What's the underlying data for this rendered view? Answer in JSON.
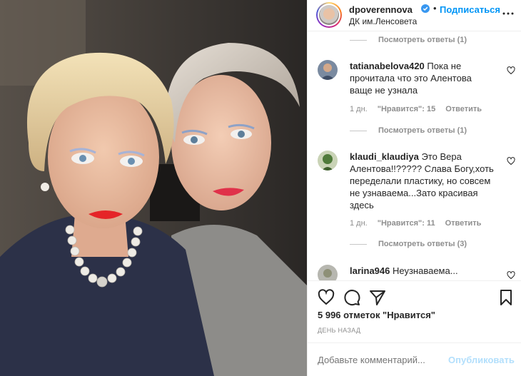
{
  "post": {
    "username": "dpoverennova",
    "follow_label": "Подписаться",
    "separator": "•",
    "location": "ДК им.Ленсовета",
    "photo_alt": "Селфи двух женщин"
  },
  "comments": {
    "view_replies_top": "Посмотреть ответы (1)",
    "items": [
      {
        "username": "tatianabelova420",
        "text": "Пока не прочитала что это Алентова ваще не узнала",
        "time": "1 дн.",
        "likes": "\"Нравится\": 15",
        "reply": "Ответить",
        "view_replies": "Посмотреть ответы (1)"
      },
      {
        "username": "klaudi_klaudiya",
        "text": "Это Вера Алентова!!????? Слава Богу,хоть переделали пластику, но совсем не узнаваема...Зато красивая здесь",
        "time": "1 дн.",
        "likes": "\"Нравится\": 11",
        "reply": "Ответить",
        "view_replies": "Посмотреть ответы (3)"
      },
      {
        "username": "larina946",
        "text": "Неузнаваема..."
      }
    ]
  },
  "actions": {
    "likes_count": "5 996 отметок \"Нравится\"",
    "posted_ago": "ДЕНЬ НАЗАД"
  },
  "add_comment": {
    "placeholder": "Добавьте комментарий...",
    "publish_label": "Опубликовать"
  },
  "colors": {
    "link_blue": "#0095f6",
    "publish_disabled": "#b2dffc",
    "muted": "#8e8e8e",
    "text": "#262626"
  }
}
